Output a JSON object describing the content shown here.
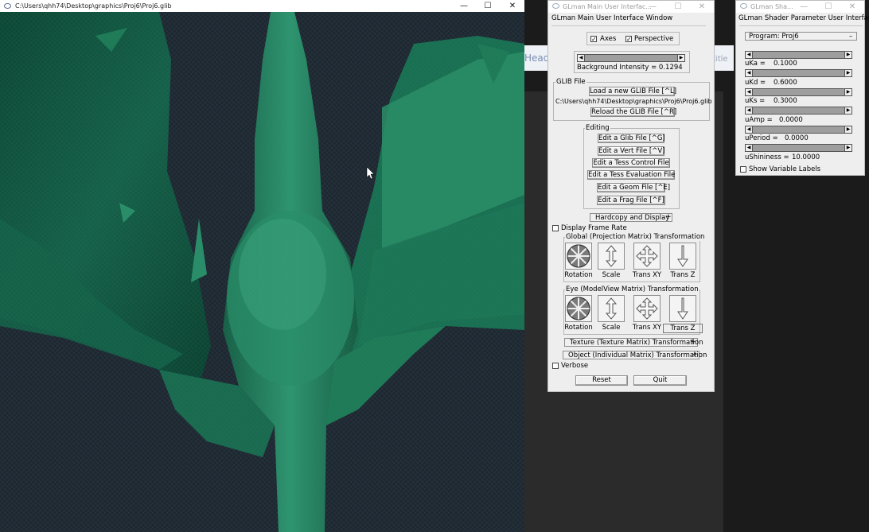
{
  "viewer": {
    "title": "C:\\Users\\qhh74\\Desktop\\graphics\\Proj6\\Proj6.glib",
    "controls": {
      "minimize": "—",
      "maximize": "☐",
      "close": "✕"
    }
  },
  "background": {
    "head_text": "Head",
    "title_text": "title"
  },
  "main_panel": {
    "window_title": "GLman Main User Interfac...",
    "header": "GLman Main User Interface Window",
    "axes_label": "Axes",
    "axes_checked": true,
    "perspective_label": "Perspective",
    "perspective_checked": true,
    "background_intensity_label": "Background Intensity = 0.1294",
    "background_intensity_value": 0.1294,
    "glib_file": {
      "group_label": "GLIB File",
      "load_button": "Load a new GLIB File [^L]",
      "path": "C:\\Users\\qhh74\\Desktop\\graphics\\Proj6\\Proj6.glib",
      "reload_button": "Reload the GLIB File [^R]"
    },
    "editing": {
      "group_label": "Editing",
      "buttons": [
        "Edit a Glib File [^G]",
        "Edit a Vert File [^V]",
        "Edit a Tess Control File",
        "Edit a Tess Evaluation File",
        "Edit a Geom File [^E]",
        "Edit a Frag File [^F]"
      ]
    },
    "hardcopy_label": "Hardcopy and Display",
    "display_frame_rate_label": "Display Frame Rate",
    "display_frame_rate_checked": false,
    "global_group": {
      "label": "Global (Projection Matrix) Transformation",
      "controls": [
        "Rotation",
        "Scale",
        "Trans XY",
        "Trans Z"
      ]
    },
    "eye_group": {
      "label": "Eye (ModelView Matrix) Transformation",
      "controls": [
        "Rotation",
        "Scale",
        "Trans XY",
        "Trans Z"
      ]
    },
    "texture_label": "Texture (Texture Matrix) Transformation",
    "object_label": "Object (Individual Matrix) Transformation",
    "verbose_label": "Verbose",
    "verbose_checked": false,
    "reset_button": "Reset",
    "quit_button": "Quit"
  },
  "shader_panel": {
    "window_title": "GLman Sha...",
    "header": "GLman Shader Parameter User Interface",
    "program_label": "Program: Proj6",
    "program_minus": "–",
    "params": [
      {
        "text": "uKa =",
        "value": "0.1000"
      },
      {
        "text": "uKd =",
        "value": "0.6000"
      },
      {
        "text": "uKs =",
        "value": "0.3000"
      },
      {
        "text": "uAmp =",
        "value": "0.0000"
      },
      {
        "text": "uPeriod =",
        "value": "0.0000"
      },
      {
        "text": "uShininess =",
        "value": "10.0000"
      }
    ],
    "show_labels_label": "Show Variable Labels",
    "show_labels_checked": false
  },
  "colors": {
    "viewer_bg": "#202632",
    "surface_dark": "#0f4d38",
    "surface_mid": "#1f7a58",
    "surface_light": "#3aa37b",
    "panel_bg": "#eeeeee"
  }
}
